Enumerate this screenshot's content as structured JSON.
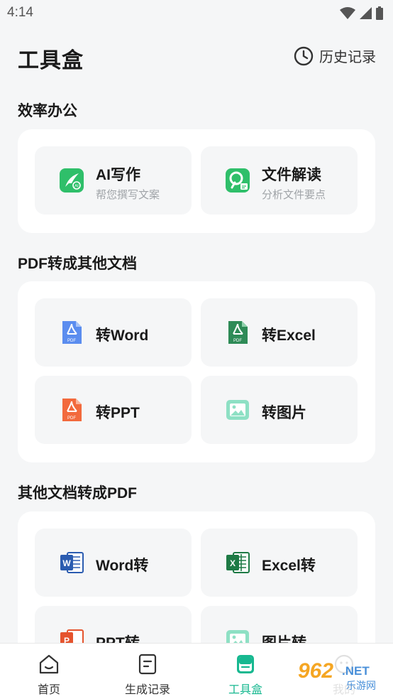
{
  "status_bar": {
    "time": "4:14"
  },
  "header": {
    "title": "工具盒",
    "history_label": "历史记录"
  },
  "sections": [
    {
      "title": "效率办公",
      "tiles": [
        {
          "title": "AI写作",
          "subtitle": "帮您撰写文案",
          "icon": "ai-writing-icon"
        },
        {
          "title": "文件解读",
          "subtitle": "分析文件要点",
          "icon": "file-analysis-icon"
        }
      ]
    },
    {
      "title": "PDF转成其他文档",
      "tiles": [
        {
          "title": "转Word",
          "icon": "pdf-blue-icon"
        },
        {
          "title": "转Excel",
          "icon": "pdf-green-icon"
        },
        {
          "title": "转PPT",
          "icon": "pdf-orange-icon"
        },
        {
          "title": "转图片",
          "icon": "image-icon"
        }
      ]
    },
    {
      "title": "其他文档转成PDF",
      "tiles": [
        {
          "title": "Word转",
          "icon": "word-icon"
        },
        {
          "title": "Excel转",
          "icon": "excel-icon"
        },
        {
          "title": "PPT转",
          "icon": "ppt-icon"
        },
        {
          "title": "图片转",
          "icon": "image-icon"
        }
      ]
    }
  ],
  "bottom_nav": [
    {
      "label": "首页",
      "icon": "home-icon"
    },
    {
      "label": "生成记录",
      "icon": "document-icon"
    },
    {
      "label": "工具盒",
      "icon": "toolbox-icon",
      "active": true
    },
    {
      "label": "我的",
      "icon": "profile-icon"
    }
  ],
  "watermark": {
    "text": "962.NET",
    "subtext": "乐游网"
  },
  "colors": {
    "accent": "#17b890",
    "word": "#2b5cb0",
    "excel": "#1e7a45",
    "ppt": "#e5532d",
    "pdf_blue": "#5b8def"
  }
}
